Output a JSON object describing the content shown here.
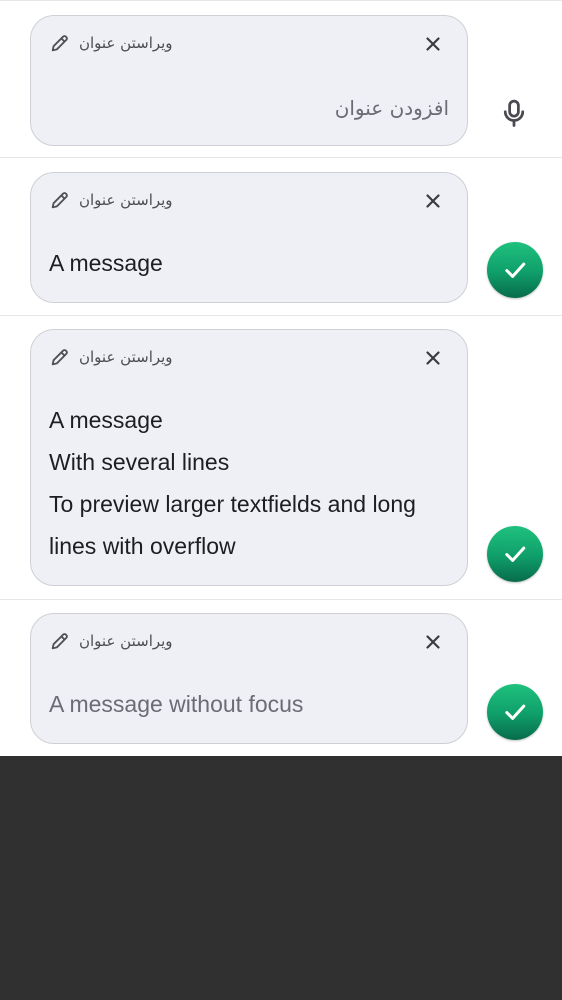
{
  "colors": {
    "card_background": "#eff0f5",
    "card_border": "#cfd0d6",
    "accent_green": "#0f9e6a",
    "page_background": "#ffffff",
    "bottom_background": "#303030"
  },
  "composers": [
    {
      "edit_title_label": "ویراستن عنوان",
      "text": "افزودن عنوان",
      "text_state": "placeholder",
      "trailing_action": "microphone-icon"
    },
    {
      "edit_title_label": "ویراستن عنوان",
      "text": "A message",
      "text_state": "value",
      "trailing_action": "check-icon"
    },
    {
      "edit_title_label": "ویراستن عنوان",
      "lines": [
        "A message",
        "With several lines",
        "To preview larger textfields and long",
        "lines with overflow"
      ],
      "text_state": "value",
      "trailing_action": "check-icon"
    },
    {
      "edit_title_label": "ویراستن عنوان",
      "text": "A message without focus",
      "text_state": "unfocused",
      "trailing_action": "check-icon"
    }
  ]
}
